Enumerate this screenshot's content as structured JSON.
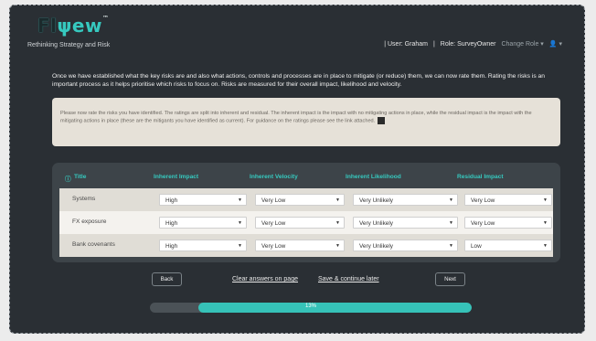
{
  "app": {
    "logo_part1": "Fl",
    "logo_part2": "ψew",
    "logo_tm": "™",
    "tagline": "Rethinking Strategy and Risk"
  },
  "topbar": {
    "user": "| User: Graham",
    "sep": "|",
    "role": "Role: SurveyOwner",
    "change_role": "Change Role ▾",
    "user_icon": "user-icon",
    "user_menu": "👤 ▾"
  },
  "intro": "Once we have established what the key risks are and also what actions, controls and processes are in place to mitigate (or reduce) them, we can now rate them. Rating the risks is an important process as it helps prioritise which risks to focus on. Risks are measured for their overall impact, likelihood and velocity.",
  "notice": "Please now rate the risks you have identified. The ratings are split into inherent and residual. The inherent impact is the impact with no mitigating actions in place, while the residual impact is the impact with the mitigating actions in place (these are the mitigants you have identified as current). For guidance on the ratings please see the link attached.",
  "table": {
    "headers": {
      "title": "Title",
      "inherent_impact": "Inherent Impact",
      "inherent_velocity": "Inherent Velocity",
      "inherent_likelihood": "Inherent Likelihood",
      "residual_impact": "Residual Impact"
    },
    "rows": [
      {
        "title": "Systems",
        "inherent_impact": "High",
        "inherent_velocity": "Very Low",
        "inherent_likelihood": "Very Unlikely",
        "residual_impact": "Very Low"
      },
      {
        "title": "FX exposure",
        "inherent_impact": "High",
        "inherent_velocity": "Very Low",
        "inherent_likelihood": "Very Unlikely",
        "residual_impact": "Very Low"
      },
      {
        "title": "Bank covenants",
        "inherent_impact": "High",
        "inherent_velocity": "Very Low",
        "inherent_likelihood": "Very Unlikely",
        "residual_impact": "Low"
      }
    ]
  },
  "nav": {
    "back": "Back",
    "clear": "Clear answers on page",
    "save": "Save & continue later",
    "next": "Next"
  },
  "progress": {
    "value": 0.13,
    "label": "13%"
  },
  "colors": {
    "accent": "#36c9bf",
    "background": "#2a2f34"
  }
}
